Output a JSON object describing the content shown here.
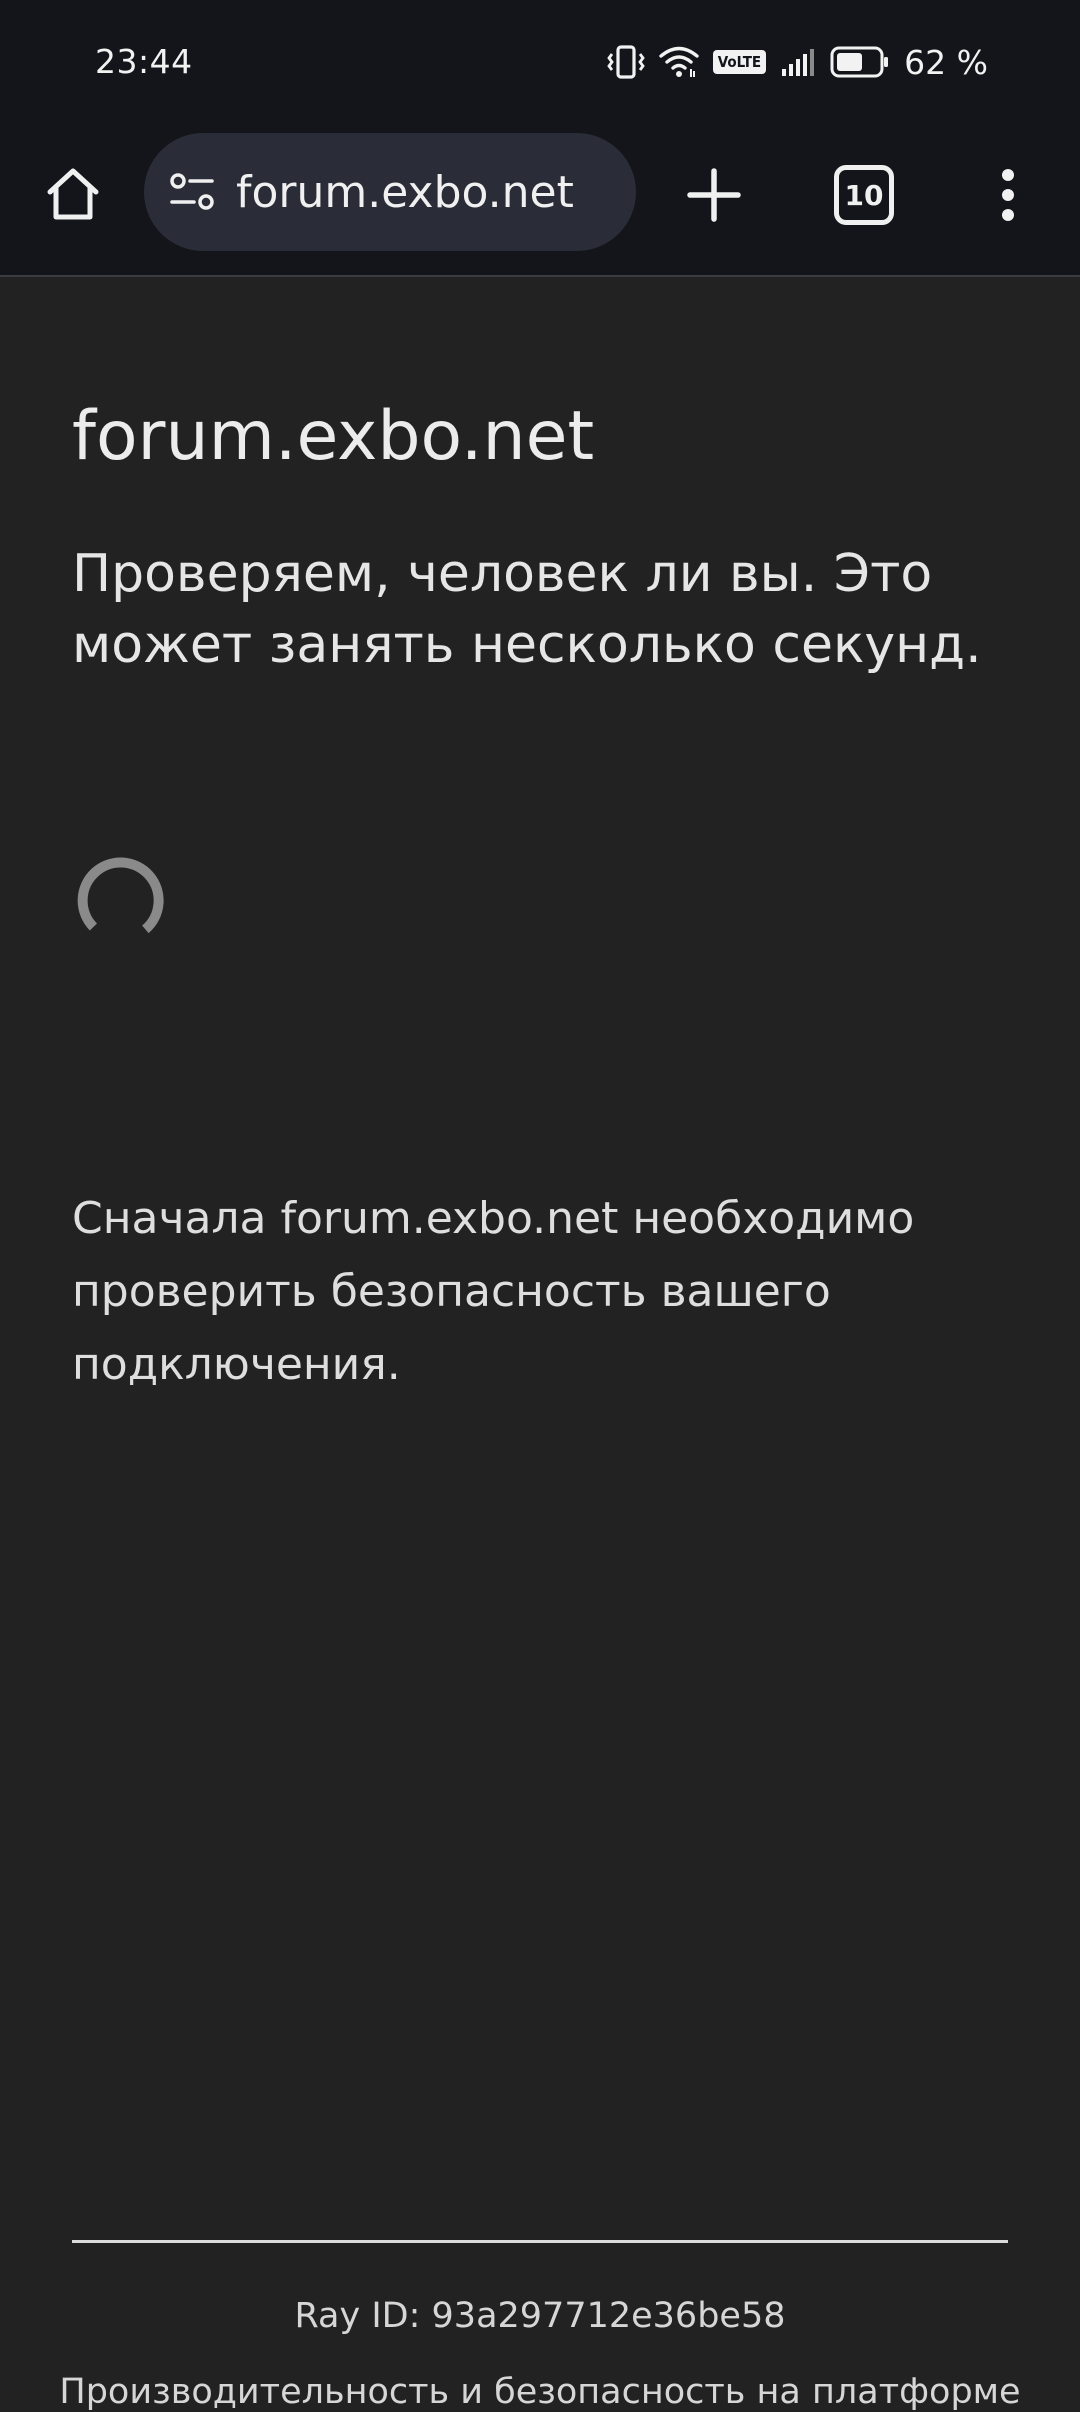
{
  "status_bar": {
    "time": "23:44",
    "network_badge": "VoLTE",
    "battery_percent": "62 %",
    "battery_level": 0.62,
    "icons": [
      "vibrate-icon",
      "wifi-icon",
      "volte-icon",
      "signal-icon",
      "battery-icon"
    ]
  },
  "toolbar": {
    "url": "forum.exbo.net",
    "tab_count": "10",
    "icons": [
      "home-icon",
      "site-info-icon",
      "plus-icon",
      "tab-switcher-icon",
      "more-vert-icon"
    ]
  },
  "page": {
    "title": "forum.exbo.net",
    "subtitle": "Проверяем, человек ли вы. Это может занять несколько секунд.",
    "note": "Сначала forum.exbo.net необходимо проверить безопасность вашего подключения.",
    "ray_id": "Ray ID: 93a297712e36be58",
    "footer": "Производительность и безопасность на платформе"
  },
  "colors": {
    "page_background": "#222222",
    "toolbar_background": "#13151b",
    "omnibox_background": "#2a2d38",
    "spinner": "#8a8a8a"
  }
}
